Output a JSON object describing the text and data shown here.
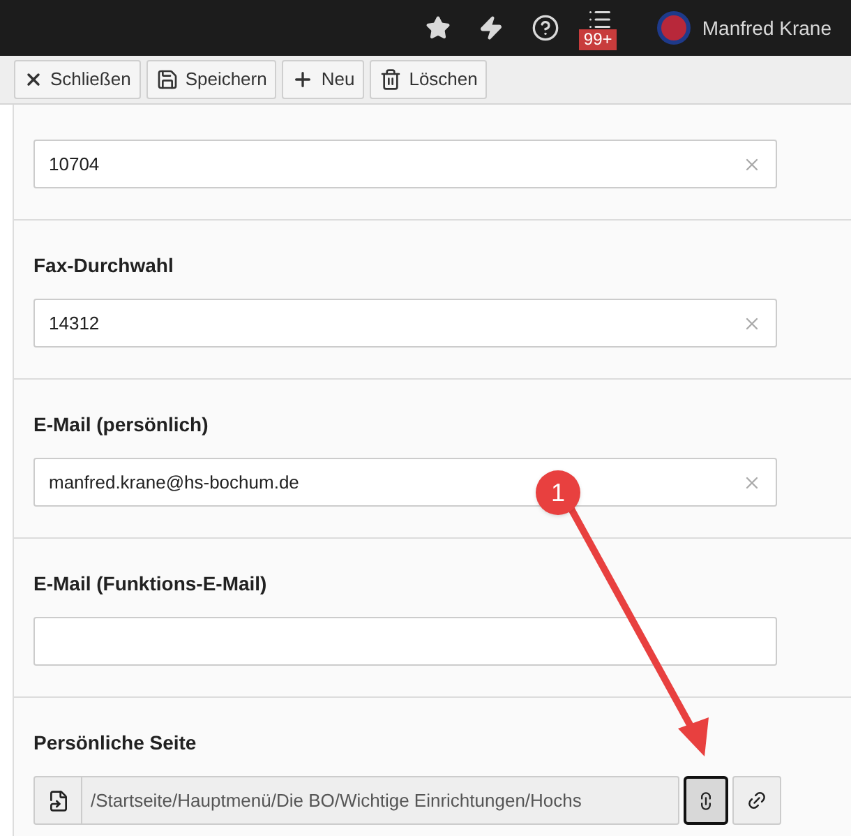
{
  "top_bar": {
    "notification_badge": "99+",
    "user_name": "Manfred Krane"
  },
  "toolbar": {
    "buttons": [
      {
        "kind": "close",
        "label": "Schließen"
      },
      {
        "kind": "save",
        "label": "Speichern"
      },
      {
        "kind": "new",
        "label": "Neu"
      },
      {
        "kind": "delete",
        "label": "Löschen"
      }
    ]
  },
  "fields": [
    {
      "value": "10704"
    },
    {
      "label": "Fax-Durchwahl",
      "value": "14312"
    },
    {
      "label": "E-Mail (persönlich)",
      "value": "manfred.krane@hs-bochum.de"
    },
    {
      "label": "E-Mail (Funktions-E-Mail)"
    }
  ],
  "link_field": {
    "label": "Persönliche Seite",
    "value": "/Startseite/Hauptmenü/Die BO/Wichtige Einrichtungen/Hochs",
    "browse_pressed": true
  },
  "annotation": {
    "number": "1"
  }
}
